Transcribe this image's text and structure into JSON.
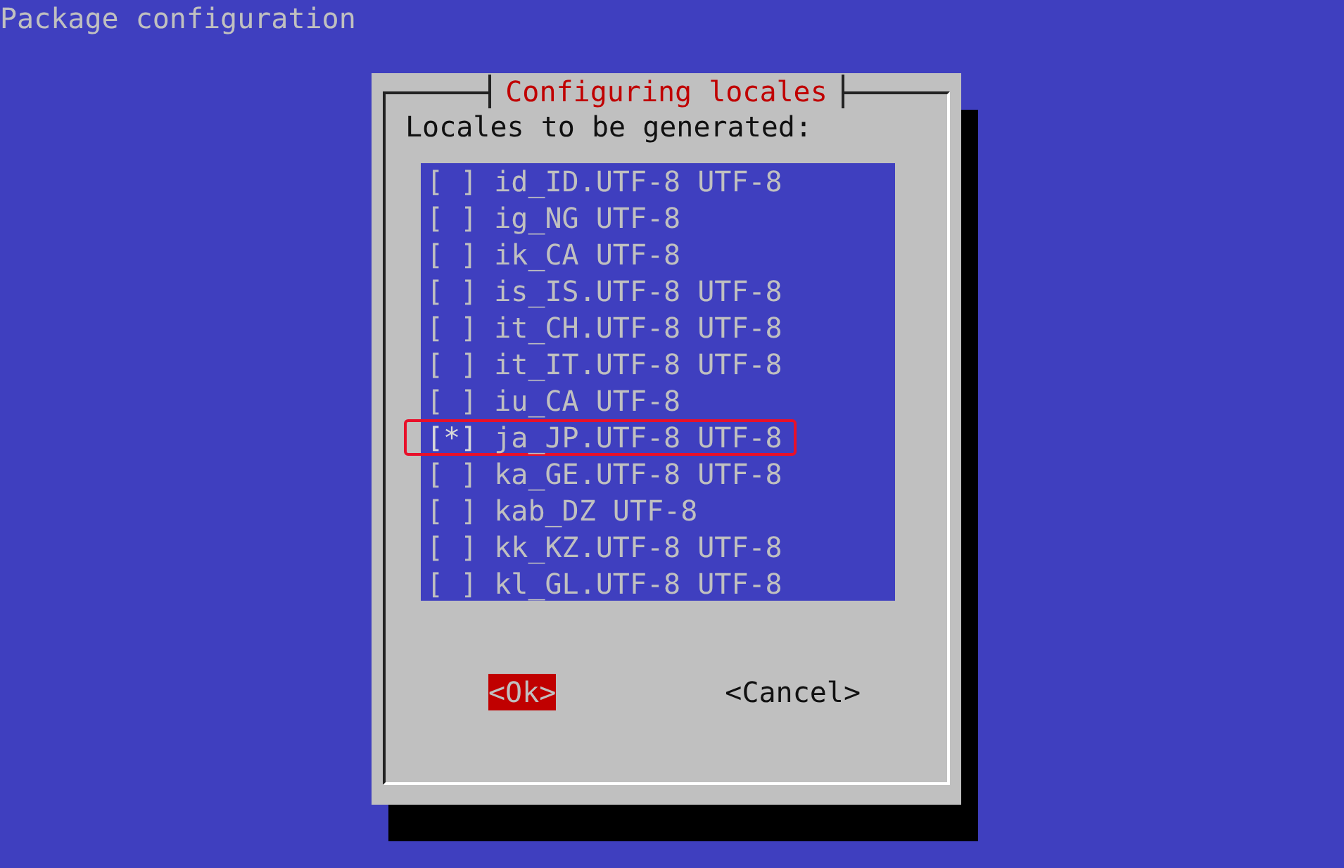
{
  "screen_title": "Package configuration",
  "dialog": {
    "title": "Configuring locales",
    "prompt": "Locales to be generated:",
    "items": [
      {
        "checkbox": "[ ]",
        "checked": false,
        "label": "id_ID.UTF-8 UTF-8",
        "highlighted": false
      },
      {
        "checkbox": "[ ]",
        "checked": false,
        "label": "ig_NG UTF-8",
        "highlighted": false
      },
      {
        "checkbox": "[ ]",
        "checked": false,
        "label": "ik_CA UTF-8",
        "highlighted": false
      },
      {
        "checkbox": "[ ]",
        "checked": false,
        "label": "is_IS.UTF-8 UTF-8",
        "highlighted": false
      },
      {
        "checkbox": "[ ]",
        "checked": false,
        "label": "it_CH.UTF-8 UTF-8",
        "highlighted": false
      },
      {
        "checkbox": "[ ]",
        "checked": false,
        "label": "it_IT.UTF-8 UTF-8",
        "highlighted": false
      },
      {
        "checkbox": "[ ]",
        "checked": false,
        "label": "iu_CA UTF-8",
        "highlighted": false
      },
      {
        "checkbox": "[*]",
        "checked": true,
        "label": "ja_JP.UTF-8 UTF-8",
        "highlighted": true
      },
      {
        "checkbox": "[ ]",
        "checked": false,
        "label": "ka_GE.UTF-8 UTF-8",
        "highlighted": false
      },
      {
        "checkbox": "[ ]",
        "checked": false,
        "label": "kab_DZ UTF-8",
        "highlighted": false
      },
      {
        "checkbox": "[ ]",
        "checked": false,
        "label": "kk_KZ.UTF-8 UTF-8",
        "highlighted": false
      },
      {
        "checkbox": "[ ]",
        "checked": false,
        "label": "kl_GL.UTF-8 UTF-8",
        "highlighted": false
      }
    ],
    "buttons": [
      {
        "label": "<Ok>",
        "selected": true
      },
      {
        "label": "<Cancel>",
        "selected": false
      }
    ]
  }
}
